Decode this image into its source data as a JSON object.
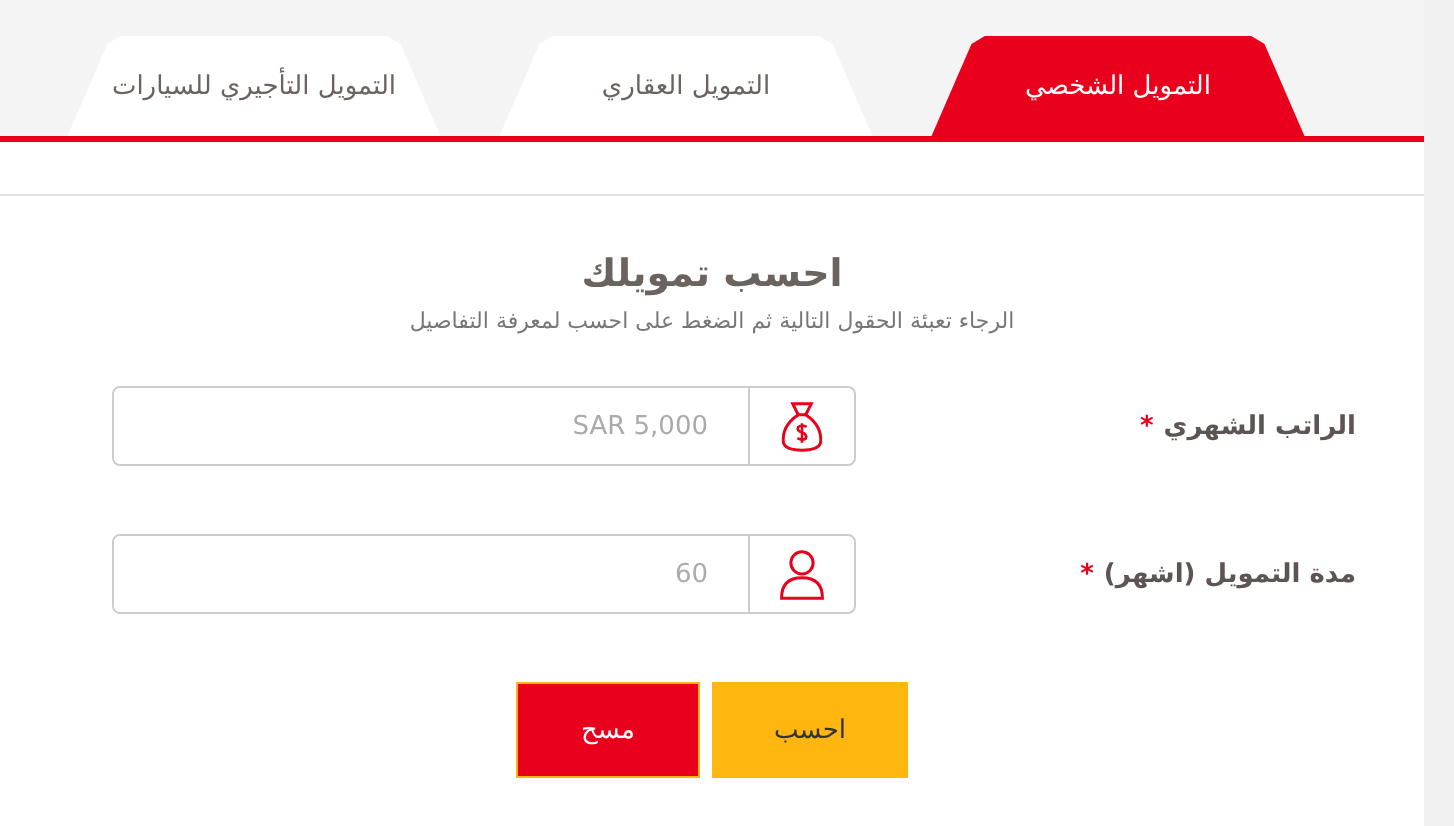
{
  "tabs": [
    {
      "label": "التمويل الشخصي",
      "selected": true
    },
    {
      "label": "التمويل العقاري",
      "selected": false
    },
    {
      "label": "التمويل التأجيري للسيارات",
      "selected": false
    }
  ],
  "form": {
    "title": "احسب تمويلك",
    "subtitle": "الرجاء تعبئة الحقول التالية ثم الضغط على احسب لمعرفة التفاصيل",
    "fields": [
      {
        "label": "الراتب الشهري",
        "required": true,
        "required_mark": "*",
        "placeholder": "SAR 5,000",
        "kind": "salary"
      },
      {
        "label": "مدة التمويل (اشهر)",
        "required": true,
        "required_mark": "*",
        "placeholder": "60",
        "kind": "duration"
      }
    ],
    "buttons": [
      {
        "label": "احسب",
        "kind": "primary"
      },
      {
        "label": "مسح",
        "kind": "reset"
      }
    ]
  }
}
